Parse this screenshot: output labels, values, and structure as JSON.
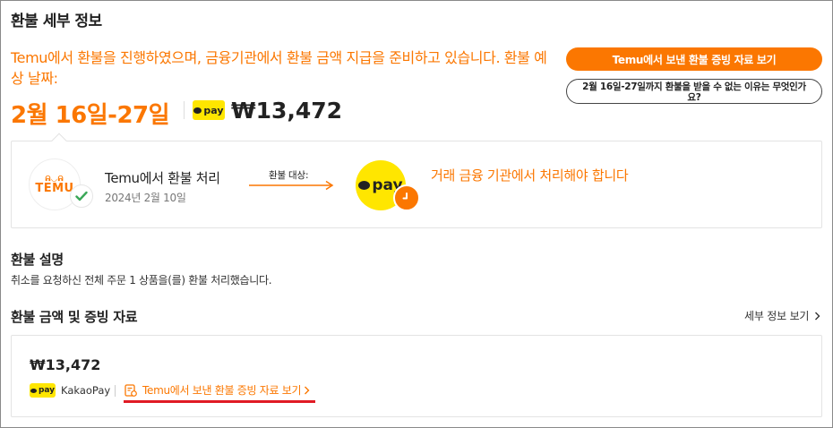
{
  "header": {
    "title": "환불 세부 정보",
    "headline": "Temu에서 환불을 진행하였으며, 금융기관에서 환불 금액 지급을 준비하고 있습니다. 환불 예상 날짜:",
    "date_range": "2월 16일-27일",
    "pay_badge": "pay",
    "amount": "₩13,472",
    "proof_button": "Temu에서 보낸 환불 증빙 자료 보기",
    "why_button": "2월 16일-27일까지 환불을 받을 수 없는 이유는 무엇인가요?"
  },
  "progress": {
    "step1_logo_top": "ᕱ◡ᕱ",
    "step1_logo_word": "TEMU",
    "step1_title": "Temu에서 환불 처리",
    "step1_date": "2024년 2월 10일",
    "arrow_label": "환불 대상:",
    "step2_pay": "pay",
    "step2_text": "거래 금융 기관에서 처리해야 합니다"
  },
  "description": {
    "title": "환불 설명",
    "text": "취소를 요청하신 전체 주문 1 상품을(를) 환불 처리했습니다."
  },
  "proof": {
    "title": "환불 금액 및 증빙 자료",
    "detail_link": "세부 정보 보기",
    "amount": "₩13,472",
    "pay_badge": "pay",
    "method": "KakaoPay",
    "proof_link": "Temu에서 보낸 환불 증빙 자료 보기"
  },
  "colors": {
    "accent": "#fb7701",
    "kakao_yellow": "#ffe600",
    "success_green": "#3aa757",
    "highlight_red": "#e01b24"
  },
  "icons": {
    "check": "check-icon",
    "clock": "clock-icon",
    "chevron": "chevron-right-icon",
    "document": "document-icon"
  }
}
